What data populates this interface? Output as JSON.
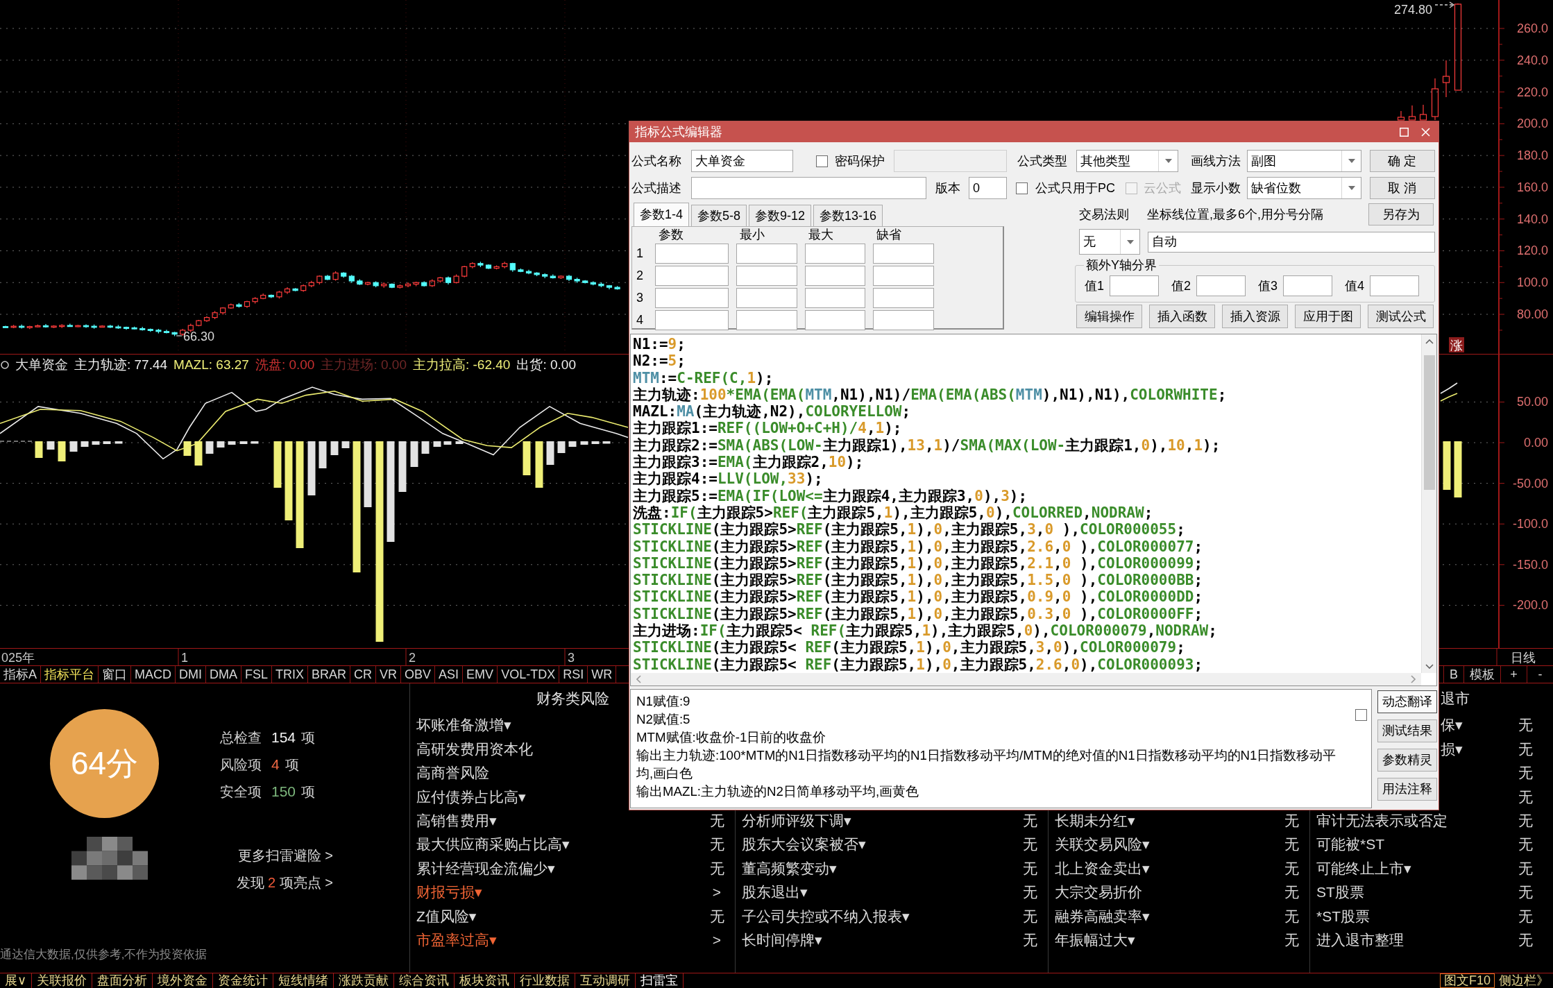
{
  "price_chart": {
    "axis_labels": [
      "260.0",
      "240.0",
      "220.0",
      "200.0",
      "180.0",
      "160.0",
      "140.0",
      "120.0",
      "100.0",
      "80.00"
    ],
    "high_label": "274.80",
    "low_label": "66.30",
    "rise_marker": "涨"
  },
  "indicator": {
    "name": "大单资金",
    "readings": [
      {
        "text": "主力轨迹: 77.44",
        "color": "#f0f0f0"
      },
      {
        "text": "MAZL: 63.27",
        "color": "#f0f07a"
      },
      {
        "text": "洗盘: 0.00",
        "color": "#c83030"
      },
      {
        "text": "主力进场: 0.00",
        "color": "#6e2626"
      },
      {
        "text": "主力拉高: -62.40",
        "color": "#f0f07a"
      },
      {
        "text": "出货: 0.00",
        "color": "#f0f0f0"
      }
    ],
    "axis_labels": [
      "50.00",
      "0.00",
      "-50.00",
      "-100.0",
      "-150.0",
      "-200.0"
    ]
  },
  "date_axis": {
    "labels": [
      "025年",
      "1",
      "2",
      "3"
    ],
    "period": "日线"
  },
  "indicator_tabs": [
    {
      "label": "指标A",
      "selected": false
    },
    {
      "label": "指标平台",
      "selected": true
    },
    {
      "label": "窗口",
      "selected": false
    },
    {
      "label": "MACD",
      "selected": false
    },
    {
      "label": "DMI",
      "selected": false
    },
    {
      "label": "DMA",
      "selected": false
    },
    {
      "label": "FSL",
      "selected": false
    },
    {
      "label": "TRIX",
      "selected": false
    },
    {
      "label": "BRAR",
      "selected": false
    },
    {
      "label": "CR",
      "selected": false
    },
    {
      "label": "VR",
      "selected": false
    },
    {
      "label": "OBV",
      "selected": false
    },
    {
      "label": "ASI",
      "selected": false
    },
    {
      "label": "EMV",
      "selected": false
    },
    {
      "label": "VOL-TDX",
      "selected": false
    },
    {
      "label": "RSI",
      "selected": false
    },
    {
      "label": "WR",
      "selected": false
    }
  ],
  "window_tools": [
    {
      "label": "B",
      "kind": "tab"
    },
    {
      "label": "模板",
      "kind": "tab"
    },
    {
      "label": "+",
      "kind": "add"
    },
    {
      "label": "-",
      "kind": "remove"
    }
  ],
  "scan_summary": {
    "score": "64分",
    "stats": [
      {
        "label": "总检查",
        "count": "154",
        "unit": "项",
        "kind": "total"
      },
      {
        "label": "风险项",
        "count": "4",
        "unit": "项",
        "kind": "risk"
      },
      {
        "label": "安全项",
        "count": "150",
        "unit": "项",
        "kind": "safe"
      }
    ],
    "more_link": "更多扫雷避险 >",
    "highlights": {
      "prefix": "发现",
      "count": "2",
      "suffix": "项亮点 >"
    },
    "disclaimer": "通达信大数据,仅供参考,不作为投资依据"
  },
  "risk_columns": [
    {
      "header": {
        "text": "财务类风险",
        "kind": "full"
      },
      "items": [
        {
          "label": "坏账准备激增▾",
          "alert": false
        },
        {
          "label": "高研发费用资本化",
          "alert": false
        },
        {
          "label": "高商誉风险",
          "alert": false
        },
        {
          "label": "应付债券占比高▾",
          "alert": false
        },
        {
          "label": "高销售费用▾",
          "alert": false,
          "value": "无"
        },
        {
          "label": "最大供应商采购占比高▾",
          "alert": false,
          "value": "无"
        },
        {
          "label": "累计经营现金流偏少▾",
          "alert": false,
          "value": "无"
        },
        {
          "label": "财报亏损▾",
          "alert": true,
          "value": ">"
        },
        {
          "label": "Z值风险▾",
          "alert": false,
          "value": "无"
        },
        {
          "label": "市盈率过高▾",
          "alert": true,
          "value": ">"
        }
      ]
    },
    {
      "items": [
        {
          "label": "分析师评级下调▾",
          "alert": false,
          "value": "无"
        },
        {
          "label": "股东大会议案被否▾",
          "alert": false,
          "value": "无"
        },
        {
          "label": "董高频繁变动▾",
          "alert": false,
          "value": "无"
        },
        {
          "label": "股东退出▾",
          "alert": false,
          "value": "无"
        },
        {
          "label": "子公司失控或不纳入报表▾",
          "alert": false,
          "value": "无"
        },
        {
          "label": "长时间停牌▾",
          "alert": false,
          "value": "无"
        }
      ]
    },
    {
      "items": [
        {
          "label": "长期未分红▾",
          "alert": false,
          "value": "无"
        },
        {
          "label": "关联交易风险▾",
          "alert": false,
          "value": "无"
        },
        {
          "label": "北上资金卖出▾",
          "alert": false,
          "value": "无"
        },
        {
          "label": "大宗交易折价",
          "alert": false,
          "value": "无"
        },
        {
          "label": "融券高融卖率▾",
          "alert": false,
          "value": "无"
        },
        {
          "label": "年振幅过大▾",
          "alert": false,
          "value": "无"
        }
      ]
    },
    {
      "header": {
        "text": "退市",
        "kind": "clipped"
      },
      "items": [
        {
          "kind": "clipped",
          "label": "保▾",
          "alert": false,
          "value": "无"
        },
        {
          "kind": "clipped",
          "label": "损▾",
          "alert": false,
          "value": "无"
        },
        {
          "kind": "hidden",
          "value": "无"
        },
        {
          "kind": "hidden",
          "value": "无"
        },
        {
          "kind": "full",
          "label": "审计无法表示或否定",
          "alert": false,
          "value": "无"
        },
        {
          "kind": "full",
          "label": "可能被*ST",
          "alert": false,
          "value": "无"
        },
        {
          "kind": "full",
          "label": "可能终止上市▾",
          "alert": false,
          "value": "无"
        },
        {
          "kind": "full",
          "label": "ST股票",
          "alert": false,
          "value": "无"
        },
        {
          "kind": "full",
          "label": "*ST股票",
          "alert": false,
          "value": "无"
        },
        {
          "kind": "full",
          "label": "进入退市整理",
          "alert": false,
          "value": "无"
        }
      ]
    }
  ],
  "bottom_tabs": [
    {
      "label": "展∨",
      "selected": false
    },
    {
      "label": "关联报价",
      "selected": false
    },
    {
      "label": "盘面分析",
      "selected": false
    },
    {
      "label": "境外资金",
      "selected": false
    },
    {
      "label": "资金统计",
      "selected": false
    },
    {
      "label": "短线情绪",
      "selected": false
    },
    {
      "label": "涨跌贡献",
      "selected": false
    },
    {
      "label": "综合资讯",
      "selected": false
    },
    {
      "label": "板块资讯",
      "selected": false
    },
    {
      "label": "行业数据",
      "selected": false
    },
    {
      "label": "互动调研",
      "selected": false
    },
    {
      "label": "扫雷宝",
      "selected": true
    }
  ],
  "status_buttons": [
    {
      "label": "图文F10",
      "selected": true
    },
    {
      "label": "侧边栏》",
      "selected": false
    }
  ],
  "dialog": {
    "title": "指标公式编辑器",
    "name": {
      "label": "公式名称",
      "value": "大单资金"
    },
    "password": {
      "label": "密码保护",
      "checked": false,
      "disabled": false
    },
    "formula_type": {
      "label": "公式类型",
      "value": "其他类型"
    },
    "draw_method": {
      "label": "画线方法",
      "value": "副图"
    },
    "description_field": {
      "label": "公式描述"
    },
    "version": {
      "label": "版本",
      "value": "0"
    },
    "pc_only": {
      "label": "公式只用于PC",
      "checked": false,
      "disabled": false
    },
    "cloud": {
      "label": "云公式",
      "checked": false,
      "disabled": true
    },
    "decimals": {
      "label": "显示小数",
      "value": "缺省位数"
    },
    "side_actions": [
      "确 定",
      "取 消",
      "另存为"
    ],
    "param_tabs": [
      {
        "label": "参数1-4",
        "selected": true
      },
      {
        "label": "参数5-8",
        "selected": false
      },
      {
        "label": "参数9-12",
        "selected": false
      },
      {
        "label": "参数13-16",
        "selected": false
      }
    ],
    "param_headers": [
      "参数",
      "最小",
      "最大",
      "缺省"
    ],
    "param_rows": [
      "1",
      "2",
      "3",
      "4"
    ],
    "trade_rule": {
      "label": "交易法则",
      "value": "无"
    },
    "gridlines": {
      "label": "坐标线位置,最多6个,用分号分隔",
      "value": "自动"
    },
    "y_bounds": {
      "title": "额外Y轴分界",
      "labels": [
        "值1",
        "值2",
        "值3",
        "值4"
      ]
    },
    "tools": [
      "编辑操作",
      "插入函数",
      "插入资源",
      "应用于图",
      "测试公式"
    ],
    "code_lines": [
      {
        "segments": [
          {
            "kind": "plain",
            "text": "N1:="
          },
          {
            "kind": "num",
            "text": "9"
          },
          {
            "kind": "plain",
            "text": ";"
          }
        ]
      },
      {
        "segments": [
          {
            "kind": "plain",
            "text": "N2:="
          },
          {
            "kind": "num",
            "text": "5"
          },
          {
            "kind": "plain",
            "text": ";"
          }
        ]
      },
      {
        "segments": [
          {
            "kind": "var",
            "text": "MTM"
          },
          {
            "kind": "plain",
            "text": ":="
          },
          {
            "kind": "func",
            "text": "C-REF(C,"
          },
          {
            "kind": "num",
            "text": "1"
          },
          {
            "kind": "plain",
            "text": ");"
          }
        ]
      },
      {
        "segments": [
          {
            "kind": "plain",
            "text": "主力轨迹:"
          },
          {
            "kind": "num",
            "text": "100"
          },
          {
            "kind": "func",
            "text": "*EMA(EMA("
          },
          {
            "kind": "var",
            "text": "MTM"
          },
          {
            "kind": "plain",
            "text": ",N1),N1)/"
          },
          {
            "kind": "func",
            "text": "EMA(EMA(ABS("
          },
          {
            "kind": "var",
            "text": "MTM"
          },
          {
            "kind": "plain",
            "text": "),N1),N1),"
          },
          {
            "kind": "func",
            "text": "COLORWHITE"
          },
          {
            "kind": "plain",
            "text": ";"
          }
        ]
      },
      {
        "segments": [
          {
            "kind": "plain",
            "text": "MAZL:"
          },
          {
            "kind": "var",
            "text": "MA"
          },
          {
            "kind": "plain",
            "text": "(主力轨迹,N2),"
          },
          {
            "kind": "func",
            "text": "COLORYELLOW"
          },
          {
            "kind": "plain",
            "text": ";"
          }
        ]
      },
      {
        "segments": [
          {
            "kind": "plain",
            "text": "主力跟踪1:="
          },
          {
            "kind": "func",
            "text": "REF((LOW+O+C+H)/"
          },
          {
            "kind": "num",
            "text": "4"
          },
          {
            "kind": "plain",
            "text": ","
          },
          {
            "kind": "num",
            "text": "1"
          },
          {
            "kind": "plain",
            "text": ");"
          }
        ]
      },
      {
        "segments": [
          {
            "kind": "plain",
            "text": "主力跟踪2:="
          },
          {
            "kind": "func",
            "text": "SMA(ABS(LOW-"
          },
          {
            "kind": "plain",
            "text": "主力跟踪1),"
          },
          {
            "kind": "num",
            "text": "13"
          },
          {
            "kind": "plain",
            "text": ","
          },
          {
            "kind": "num",
            "text": "1"
          },
          {
            "kind": "plain",
            "text": ")/"
          },
          {
            "kind": "func",
            "text": "SMA(MAX(LOW-"
          },
          {
            "kind": "plain",
            "text": "主力跟踪1,"
          },
          {
            "kind": "num",
            "text": "0"
          },
          {
            "kind": "plain",
            "text": "),"
          },
          {
            "kind": "num",
            "text": "10"
          },
          {
            "kind": "plain",
            "text": ","
          },
          {
            "kind": "num",
            "text": "1"
          },
          {
            "kind": "plain",
            "text": ");"
          }
        ]
      },
      {
        "segments": [
          {
            "kind": "plain",
            "text": "主力跟踪3:="
          },
          {
            "kind": "func",
            "text": "EMA("
          },
          {
            "kind": "plain",
            "text": "主力跟踪2,"
          },
          {
            "kind": "num",
            "text": "10"
          },
          {
            "kind": "plain",
            "text": ");"
          }
        ]
      },
      {
        "segments": [
          {
            "kind": "plain",
            "text": "主力跟踪4:="
          },
          {
            "kind": "func",
            "text": "LLV(LOW,"
          },
          {
            "kind": "num",
            "text": "33"
          },
          {
            "kind": "plain",
            "text": ");"
          }
        ]
      },
      {
        "segments": [
          {
            "kind": "plain",
            "text": "主力跟踪5:="
          },
          {
            "kind": "func",
            "text": "EMA(IF(LOW<="
          },
          {
            "kind": "plain",
            "text": "主力跟踪4,主力跟踪3,"
          },
          {
            "kind": "num",
            "text": "0"
          },
          {
            "kind": "plain",
            "text": "),"
          },
          {
            "kind": "num",
            "text": "3"
          },
          {
            "kind": "plain",
            "text": ");"
          }
        ]
      },
      {
        "segments": [
          {
            "kind": "plain",
            "text": "洗盘:"
          },
          {
            "kind": "func",
            "text": "IF("
          },
          {
            "kind": "plain",
            "text": "主力跟踪5>"
          },
          {
            "kind": "func",
            "text": "REF("
          },
          {
            "kind": "plain",
            "text": "主力跟踪5,"
          },
          {
            "kind": "num",
            "text": "1"
          },
          {
            "kind": "plain",
            "text": "),主力跟踪5,"
          },
          {
            "kind": "num",
            "text": "0"
          },
          {
            "kind": "plain",
            "text": "),"
          },
          {
            "kind": "func",
            "text": "COLORRED"
          },
          {
            "kind": "plain",
            "text": ","
          },
          {
            "kind": "func",
            "text": "NODRAW"
          },
          {
            "kind": "plain",
            "text": ";"
          }
        ]
      },
      {
        "segments": [
          {
            "kind": "func",
            "text": "STICKLINE"
          },
          {
            "kind": "plain",
            "text": "(主力跟踪5>"
          },
          {
            "kind": "func",
            "text": "REF"
          },
          {
            "kind": "plain",
            "text": "(主力跟踪5,"
          },
          {
            "kind": "num",
            "text": "1"
          },
          {
            "kind": "plain",
            "text": "),"
          },
          {
            "kind": "num",
            "text": "0"
          },
          {
            "kind": "plain",
            "text": ",主力跟踪5,"
          },
          {
            "kind": "num",
            "text": "3"
          },
          {
            "kind": "plain",
            "text": ","
          },
          {
            "kind": "num",
            "text": "0"
          },
          {
            "kind": "plain",
            "text": " ),"
          },
          {
            "kind": "func",
            "text": "COLOR000055"
          },
          {
            "kind": "plain",
            "text": ";"
          }
        ]
      },
      {
        "segments": [
          {
            "kind": "func",
            "text": "STICKLINE"
          },
          {
            "kind": "plain",
            "text": "(主力跟踪5>"
          },
          {
            "kind": "func",
            "text": "REF"
          },
          {
            "kind": "plain",
            "text": "(主力跟踪5,"
          },
          {
            "kind": "num",
            "text": "1"
          },
          {
            "kind": "plain",
            "text": "),"
          },
          {
            "kind": "num",
            "text": "0"
          },
          {
            "kind": "plain",
            "text": ",主力跟踪5,"
          },
          {
            "kind": "num",
            "text": "2.6"
          },
          {
            "kind": "plain",
            "text": ","
          },
          {
            "kind": "num",
            "text": "0"
          },
          {
            "kind": "plain",
            "text": " ),"
          },
          {
            "kind": "func",
            "text": "COLOR000077"
          },
          {
            "kind": "plain",
            "text": ";"
          }
        ]
      },
      {
        "segments": [
          {
            "kind": "func",
            "text": "STICKLINE"
          },
          {
            "kind": "plain",
            "text": "(主力跟踪5>"
          },
          {
            "kind": "func",
            "text": "REF"
          },
          {
            "kind": "plain",
            "text": "(主力跟踪5,"
          },
          {
            "kind": "num",
            "text": "1"
          },
          {
            "kind": "plain",
            "text": "),"
          },
          {
            "kind": "num",
            "text": "0"
          },
          {
            "kind": "plain",
            "text": ",主力跟踪5,"
          },
          {
            "kind": "num",
            "text": "2.1"
          },
          {
            "kind": "plain",
            "text": ","
          },
          {
            "kind": "num",
            "text": "0"
          },
          {
            "kind": "plain",
            "text": " ),"
          },
          {
            "kind": "func",
            "text": "COLOR000099"
          },
          {
            "kind": "plain",
            "text": ";"
          }
        ]
      },
      {
        "segments": [
          {
            "kind": "func",
            "text": "STICKLINE"
          },
          {
            "kind": "plain",
            "text": "(主力跟踪5>"
          },
          {
            "kind": "func",
            "text": "REF"
          },
          {
            "kind": "plain",
            "text": "(主力跟踪5,"
          },
          {
            "kind": "num",
            "text": "1"
          },
          {
            "kind": "plain",
            "text": "),"
          },
          {
            "kind": "num",
            "text": "0"
          },
          {
            "kind": "plain",
            "text": ",主力跟踪5,"
          },
          {
            "kind": "num",
            "text": "1.5"
          },
          {
            "kind": "plain",
            "text": ","
          },
          {
            "kind": "num",
            "text": "0"
          },
          {
            "kind": "plain",
            "text": " ),"
          },
          {
            "kind": "func",
            "text": "COLOR0000BB"
          },
          {
            "kind": "plain",
            "text": ";"
          }
        ]
      },
      {
        "segments": [
          {
            "kind": "func",
            "text": "STICKLINE"
          },
          {
            "kind": "plain",
            "text": "(主力跟踪5>"
          },
          {
            "kind": "func",
            "text": "REF"
          },
          {
            "kind": "plain",
            "text": "(主力跟踪5,"
          },
          {
            "kind": "num",
            "text": "1"
          },
          {
            "kind": "plain",
            "text": "),"
          },
          {
            "kind": "num",
            "text": "0"
          },
          {
            "kind": "plain",
            "text": ",主力跟踪5,"
          },
          {
            "kind": "num",
            "text": "0.9"
          },
          {
            "kind": "plain",
            "text": ","
          },
          {
            "kind": "num",
            "text": "0"
          },
          {
            "kind": "plain",
            "text": " ),"
          },
          {
            "kind": "func",
            "text": "COLOR0000DD"
          },
          {
            "kind": "plain",
            "text": ";"
          }
        ]
      },
      {
        "segments": [
          {
            "kind": "func",
            "text": "STICKLINE"
          },
          {
            "kind": "plain",
            "text": "(主力跟踪5>"
          },
          {
            "kind": "func",
            "text": "REF"
          },
          {
            "kind": "plain",
            "text": "(主力跟踪5,"
          },
          {
            "kind": "num",
            "text": "1"
          },
          {
            "kind": "plain",
            "text": "),"
          },
          {
            "kind": "num",
            "text": "0"
          },
          {
            "kind": "plain",
            "text": ",主力跟踪5,"
          },
          {
            "kind": "num",
            "text": "0.3"
          },
          {
            "kind": "plain",
            "text": ","
          },
          {
            "kind": "num",
            "text": "0"
          },
          {
            "kind": "plain",
            "text": " ),"
          },
          {
            "kind": "func",
            "text": "COLOR0000FF"
          },
          {
            "kind": "plain",
            "text": ";"
          }
        ]
      },
      {
        "segments": [
          {
            "kind": "plain",
            "text": "主力进场:"
          },
          {
            "kind": "func",
            "text": "IF("
          },
          {
            "kind": "plain",
            "text": "主力跟踪5< "
          },
          {
            "kind": "func",
            "text": "REF("
          },
          {
            "kind": "plain",
            "text": "主力跟踪5,"
          },
          {
            "kind": "num",
            "text": "1"
          },
          {
            "kind": "plain",
            "text": "),主力跟踪5,"
          },
          {
            "kind": "num",
            "text": "0"
          },
          {
            "kind": "plain",
            "text": "),"
          },
          {
            "kind": "func",
            "text": "COLOR000079"
          },
          {
            "kind": "plain",
            "text": ","
          },
          {
            "kind": "func",
            "text": "NODRAW"
          },
          {
            "kind": "plain",
            "text": ";"
          }
        ]
      },
      {
        "segments": [
          {
            "kind": "func",
            "text": "STICKLINE"
          },
          {
            "kind": "plain",
            "text": "(主力跟踪5< "
          },
          {
            "kind": "func",
            "text": "REF"
          },
          {
            "kind": "plain",
            "text": "(主力跟踪5,"
          },
          {
            "kind": "num",
            "text": "1"
          },
          {
            "kind": "plain",
            "text": "),"
          },
          {
            "kind": "num",
            "text": "0"
          },
          {
            "kind": "plain",
            "text": ",主力跟踪5,"
          },
          {
            "kind": "num",
            "text": "3"
          },
          {
            "kind": "plain",
            "text": ","
          },
          {
            "kind": "num",
            "text": "0"
          },
          {
            "kind": "plain",
            "text": "),"
          },
          {
            "kind": "func",
            "text": "COLOR000079"
          },
          {
            "kind": "plain",
            "text": ";"
          }
        ]
      },
      {
        "segments": [
          {
            "kind": "func",
            "text": "STICKLINE"
          },
          {
            "kind": "plain",
            "text": "(主力跟踪5< "
          },
          {
            "kind": "func",
            "text": "REF"
          },
          {
            "kind": "plain",
            "text": "(主力跟踪5,"
          },
          {
            "kind": "num",
            "text": "1"
          },
          {
            "kind": "plain",
            "text": "),"
          },
          {
            "kind": "num",
            "text": "0"
          },
          {
            "kind": "plain",
            "text": ",主力跟踪5,"
          },
          {
            "kind": "num",
            "text": "2.6"
          },
          {
            "kind": "plain",
            "text": ","
          },
          {
            "kind": "num",
            "text": "0"
          },
          {
            "kind": "plain",
            "text": "),"
          },
          {
            "kind": "func",
            "text": "COLOR000093"
          },
          {
            "kind": "plain",
            "text": ";"
          }
        ]
      }
    ],
    "notes": {
      "checked": false,
      "lines": [
        "N1赋值:9",
        "N2赋值:5",
        "MTM赋值:收盘价-1日前的收盘价",
        "输出主力轨迹:100*MTM的N1日指数移动平均的N1日指数移动平均/MTM的绝对值的N1日指数移动平均的N1日指数移动平均,画白色",
        "输出MAZL:主力轨迹的N2日简单移动平均,画黄色"
      ]
    },
    "note_buttons": [
      {
        "label": "动态翻译",
        "selected": true
      },
      {
        "label": "测试结果",
        "selected": false
      },
      {
        "label": "参数精灵",
        "selected": false
      },
      {
        "label": "用法注释",
        "selected": false
      }
    ]
  }
}
